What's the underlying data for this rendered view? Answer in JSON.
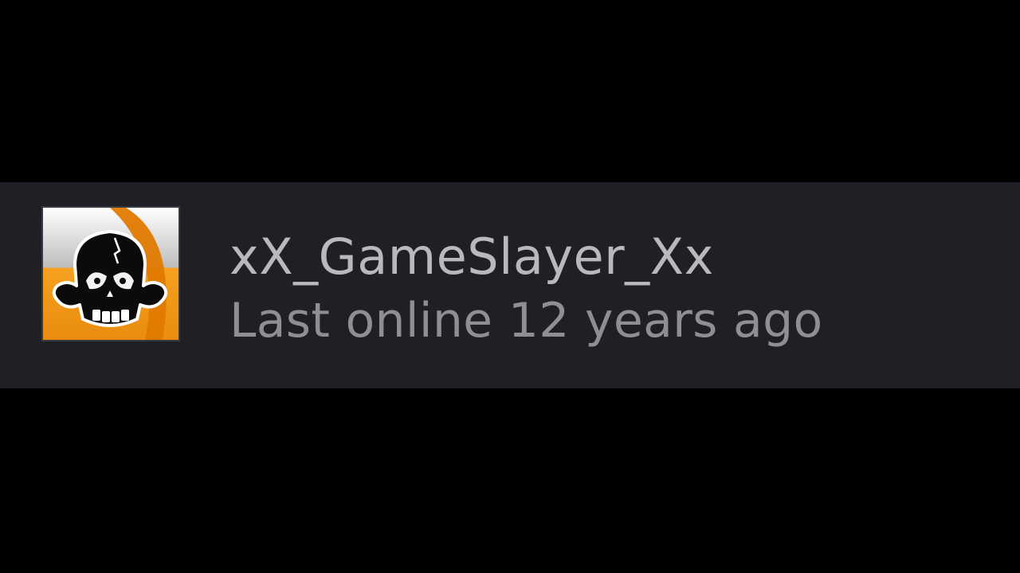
{
  "profile": {
    "username": "xX_GameSlayer_Xx",
    "status": "Last online 12 years ago",
    "avatar_icon": "skull-icon"
  },
  "colors": {
    "row_background": "#1f2026",
    "avatar_orange": "#f39a1d",
    "username_text": "#b9b9bc",
    "status_text": "#8e8f93"
  }
}
